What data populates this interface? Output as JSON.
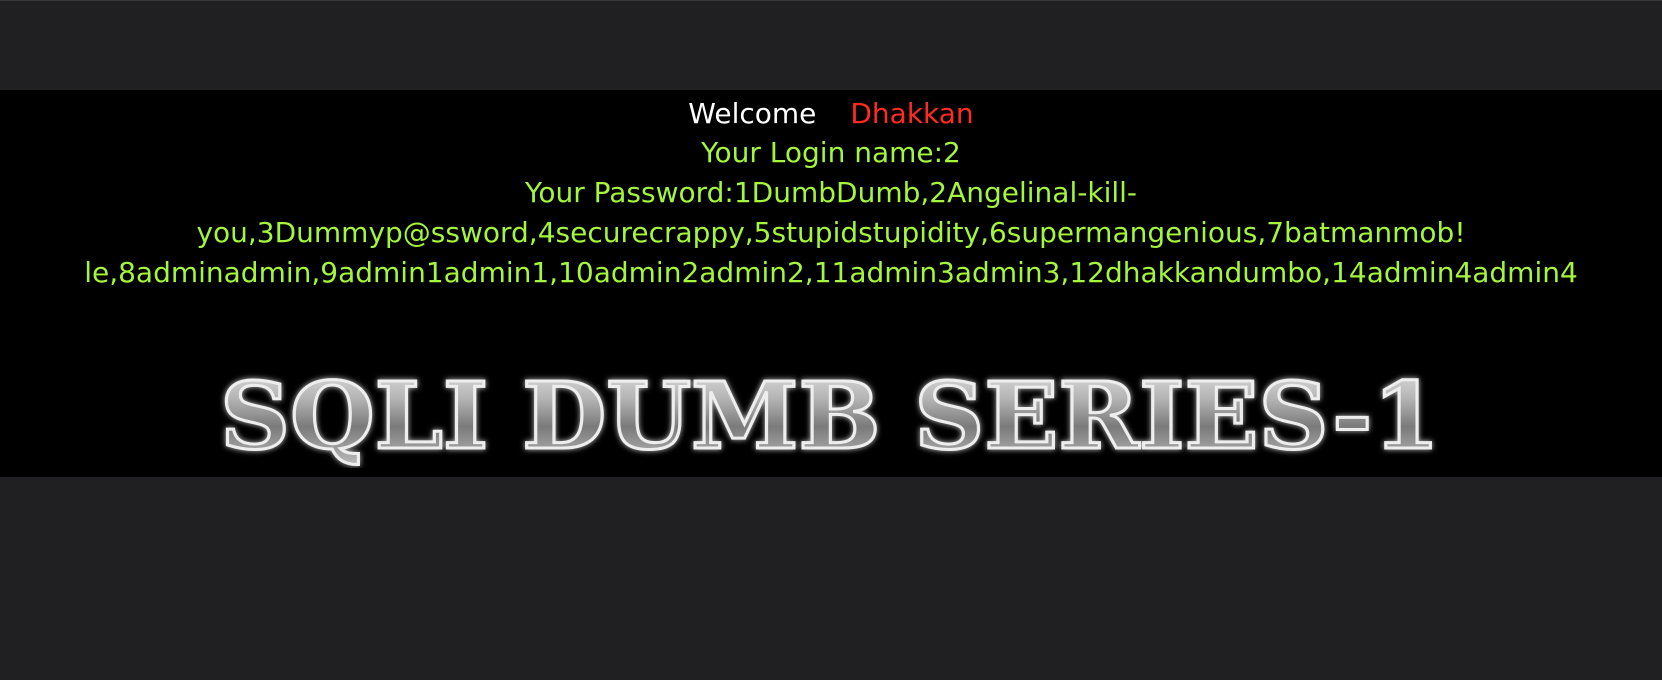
{
  "page": {
    "background_color": "#202022",
    "banner_color": "#000000"
  },
  "welcome": {
    "label": "Welcome",
    "name": "Dhakkan",
    "label_color": "#ffffff",
    "name_color": "#ff2a22"
  },
  "login": {
    "text": "Your Login name:2",
    "color": "#a4f53b"
  },
  "password": {
    "line1": "Your Password:1DumbDumb,2Angelinal-kill-",
    "line2": "you,3Dummyp@ssword,4securecrappy,5stupidstupidity,6supermangenious,7batmanmob!",
    "line3": "le,8adminadmin,9admin1admin1,10admin2admin2,11admin3admin3,12dhakkandumbo,14admin4admin4",
    "color": "#a4f53b"
  },
  "title_image": {
    "text": "SQLI DUMB SERIES-1"
  }
}
